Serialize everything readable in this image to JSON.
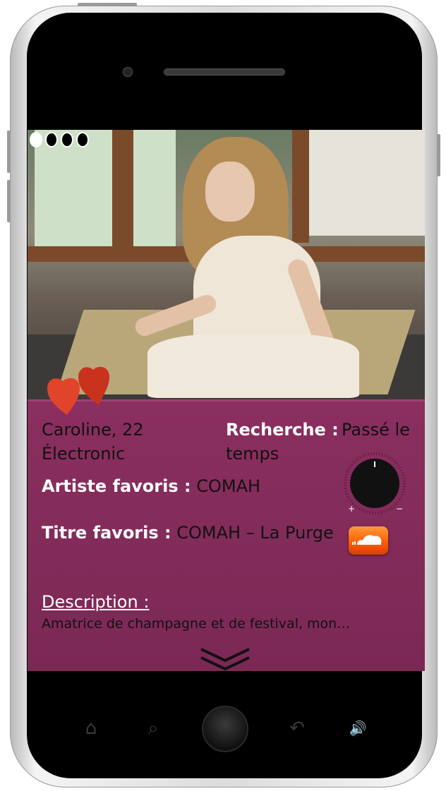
{
  "profile": {
    "name_age": "Caroline, 22",
    "genre": "Électronic",
    "search_label": "Recherche :",
    "search_value_line1": "Passé le",
    "search_value_line2": "temps",
    "artist_label": "Artiste favoris :",
    "artist_value": "COMAH",
    "title_label": "Titre favoris :",
    "title_value": "COMAH – La Purge",
    "description_label": "Description :",
    "description_text": "Amatrice de champagne et de festival, mon…"
  },
  "photo_indicator": {
    "count": 4,
    "active_index": 0
  },
  "icons": {
    "hearts": "hearts-icon",
    "knob": "volume-knob-icon",
    "soundcloud": "soundcloud-icon",
    "expand": "chevron-down-icon",
    "home": "home-icon",
    "search": "search-icon",
    "back": "back-icon",
    "volume": "volume-icon"
  },
  "colors": {
    "card_bg": "#7b2855",
    "heart_main": "#e0452b",
    "heart_back": "#c9321c",
    "soundcloud": "#ff5a00"
  },
  "system_nav": {
    "home_glyph": "⌂",
    "search_glyph": "⌕",
    "back_glyph": "↶",
    "volume_glyph": "🔊"
  }
}
